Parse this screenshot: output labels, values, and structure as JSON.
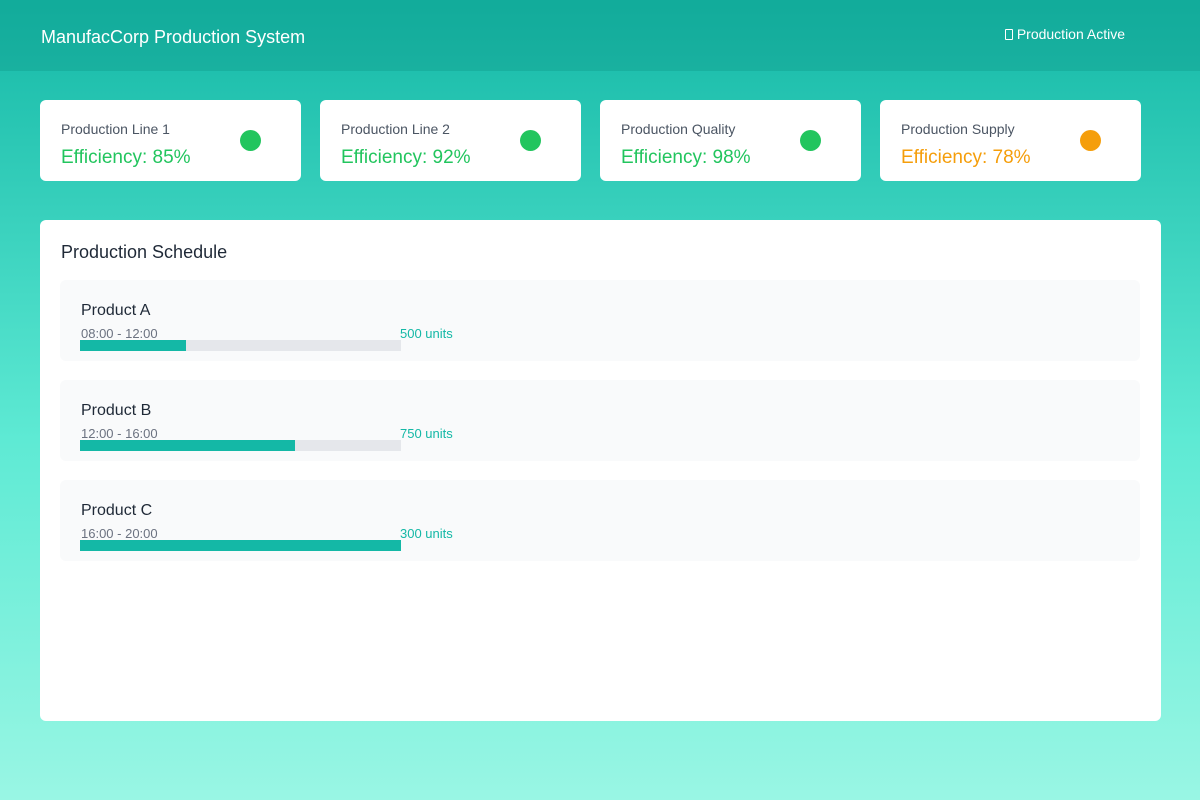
{
  "header": {
    "title": "ManufacCorp Production System",
    "status": "Production Active",
    "status_icon": "indicator-icon"
  },
  "colors": {
    "accent": "#14b8a6",
    "good": "#22c55e",
    "warning": "#f59e0b"
  },
  "cards": [
    {
      "title": "Production Line 1",
      "value": "Efficiency: 85%",
      "status_color": "#22c55e"
    },
    {
      "title": "Production Line 2",
      "value": "Efficiency: 92%",
      "status_color": "#22c55e"
    },
    {
      "title": "Production Quality",
      "value": "Efficiency: 98%",
      "status_color": "#22c55e"
    },
    {
      "title": "Production Supply",
      "value": "Efficiency: 78%",
      "status_color": "#f59e0b"
    }
  ],
  "schedule": {
    "title": "Production Schedule",
    "items": [
      {
        "name": "Product A",
        "time": "08:00 - 12:00",
        "units": "500 units",
        "progress": 0.33
      },
      {
        "name": "Product B",
        "time": "12:00 - 16:00",
        "units": "750 units",
        "progress": 0.67
      },
      {
        "name": "Product C",
        "time": "16:00 - 20:00",
        "units": "300 units",
        "progress": 1.0
      }
    ]
  }
}
